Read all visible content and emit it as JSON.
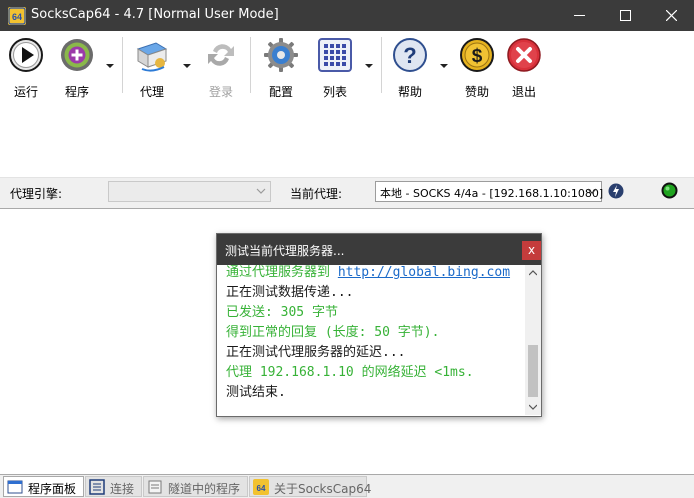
{
  "window": {
    "title": "SocksCap64 - 4.7 [Normal User Mode]",
    "icon_label": "64",
    "controls": {
      "minimize": "—",
      "maximize": "☐",
      "close": "✕"
    }
  },
  "toolbar": {
    "items": [
      {
        "label": "运行",
        "icon": "run-icon",
        "enabled": true
      },
      {
        "label": "程序",
        "icon": "add-program-icon",
        "enabled": true
      },
      {
        "label": "代理",
        "icon": "proxy-icon",
        "enabled": true
      },
      {
        "label": "登录",
        "icon": "login-icon",
        "enabled": false
      },
      {
        "label": "配置",
        "icon": "settings-gear-icon",
        "enabled": true
      },
      {
        "label": "列表",
        "icon": "list-grid-icon",
        "enabled": true
      },
      {
        "label": "帮助",
        "icon": "help-icon",
        "enabled": true
      },
      {
        "label": "赞助",
        "icon": "donate-dollar-icon",
        "enabled": true
      },
      {
        "label": "退出",
        "icon": "exit-icon",
        "enabled": true
      }
    ]
  },
  "filter": {
    "engine_label": "代理引擎:",
    "engine_value": "",
    "current_proxy_label": "当前代理:",
    "current_proxy_value": "本地 - SOCKS 4/4a - [192.168.1.10:1080]",
    "status_color": "#1fa31f"
  },
  "dialog": {
    "title": "测试当前代理服务器...",
    "close": "x",
    "log": [
      {
        "prefix": "通过代理服务器到 ",
        "link": "http://global.bing.com",
        "color": "green"
      },
      {
        "text": "正在测试数据传递...",
        "color": "black"
      },
      {
        "text": "已发送: 305 字节",
        "color": "green"
      },
      {
        "text": "得到正常的回复 (长度: 50 字节).",
        "color": "green"
      },
      {
        "text": "正在测试代理服务器的延迟...",
        "color": "black"
      },
      {
        "text": "代理 192.168.1.10 的网络延迟 <1ms.",
        "color": "green"
      },
      {
        "text": "测试结束.",
        "color": "black"
      }
    ]
  },
  "tabs": [
    {
      "label": "程序面板",
      "icon": "program-panel-icon",
      "active": true
    },
    {
      "label": "连接",
      "icon": "connection-icon",
      "active": false
    },
    {
      "label": "隧道中的程序",
      "icon": "tunnel-programs-icon",
      "active": false
    },
    {
      "label": "关于SocksCap64",
      "icon": "about-icon",
      "active": false
    }
  ]
}
